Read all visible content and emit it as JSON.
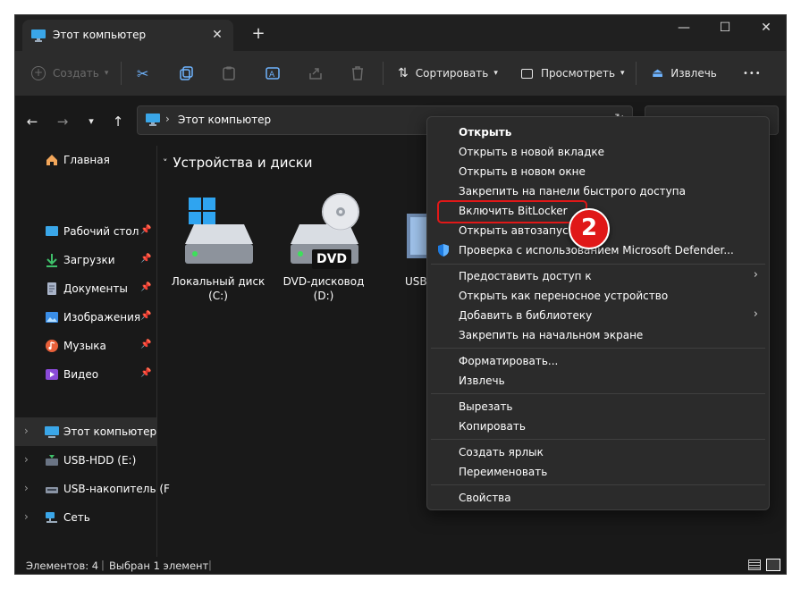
{
  "window": {
    "tab_title": "Этот компьютер",
    "tab_close": "✕",
    "new_tab": "+",
    "controls": {
      "minimize": "—",
      "maximize": "☐",
      "close": "✕"
    }
  },
  "toolbar": {
    "create_label": "Создать",
    "sort_label": "Сортировать",
    "view_label": "Просмотреть",
    "eject_label": "Извлечь",
    "more_label": "•••"
  },
  "address": {
    "path": "Этот компьютер",
    "separator": "›"
  },
  "sidebar": {
    "items": [
      {
        "label": "Главная",
        "icon": "home-icon"
      },
      {
        "label": "Рабочий стол",
        "icon": "desktop-icon",
        "pinned": true
      },
      {
        "label": "Загрузки",
        "icon": "download-icon",
        "pinned": true
      },
      {
        "label": "Документы",
        "icon": "document-icon",
        "pinned": true
      },
      {
        "label": "Изображения",
        "icon": "image-icon",
        "pinned": true
      },
      {
        "label": "Музыка",
        "icon": "music-icon",
        "pinned": true
      },
      {
        "label": "Видео",
        "icon": "video-icon",
        "pinned": true
      },
      {
        "label": "Этот компьютер",
        "icon": "computer-icon",
        "selected": true
      },
      {
        "label": "USB-HDD (E:)",
        "icon": "usb-drive-icon"
      },
      {
        "label": "USB-накопитель (F",
        "icon": "usb-stick-icon"
      },
      {
        "label": "Сеть",
        "icon": "network-icon"
      }
    ]
  },
  "content": {
    "group_title": "Устройства и диски",
    "drives": [
      {
        "line1": "Локальный диск",
        "line2": "(C:)"
      },
      {
        "line1": "DVD-дисковод",
        "line2": "(D:)",
        "badge": "DVD"
      },
      {
        "line1": "USB-HD",
        "line2": ""
      }
    ]
  },
  "status": {
    "items_count": "Элементов: 4",
    "selected": "Выбран 1 элемент"
  },
  "context_menu": {
    "open": "Открыть",
    "open_new_tab": "Открыть в новой вкладке",
    "open_new_window": "Открыть в новом окне",
    "pin_quick_access": "Закрепить на панели быстрого доступа",
    "bitlocker": "Включить BitLocker",
    "autoplay": "Открыть автозапуск...",
    "defender": "Проверка с использованием Microsoft Defender...",
    "give_access": "Предоставить доступ к",
    "open_portable": "Открыть как переносное устройство",
    "add_library": "Добавить в библиотеку",
    "pin_start": "Закрепить на начальном экране",
    "format": "Форматировать...",
    "eject": "Извлечь",
    "cut": "Вырезать",
    "copy": "Копировать",
    "create_shortcut": "Создать ярлык",
    "rename": "Переименовать",
    "properties": "Свойства"
  },
  "annotation": {
    "step": "2"
  },
  "colors": {
    "accent": "#4cc2ff",
    "highlight": "#e01818",
    "background": "#191919",
    "menu": "#2b2b2b"
  }
}
